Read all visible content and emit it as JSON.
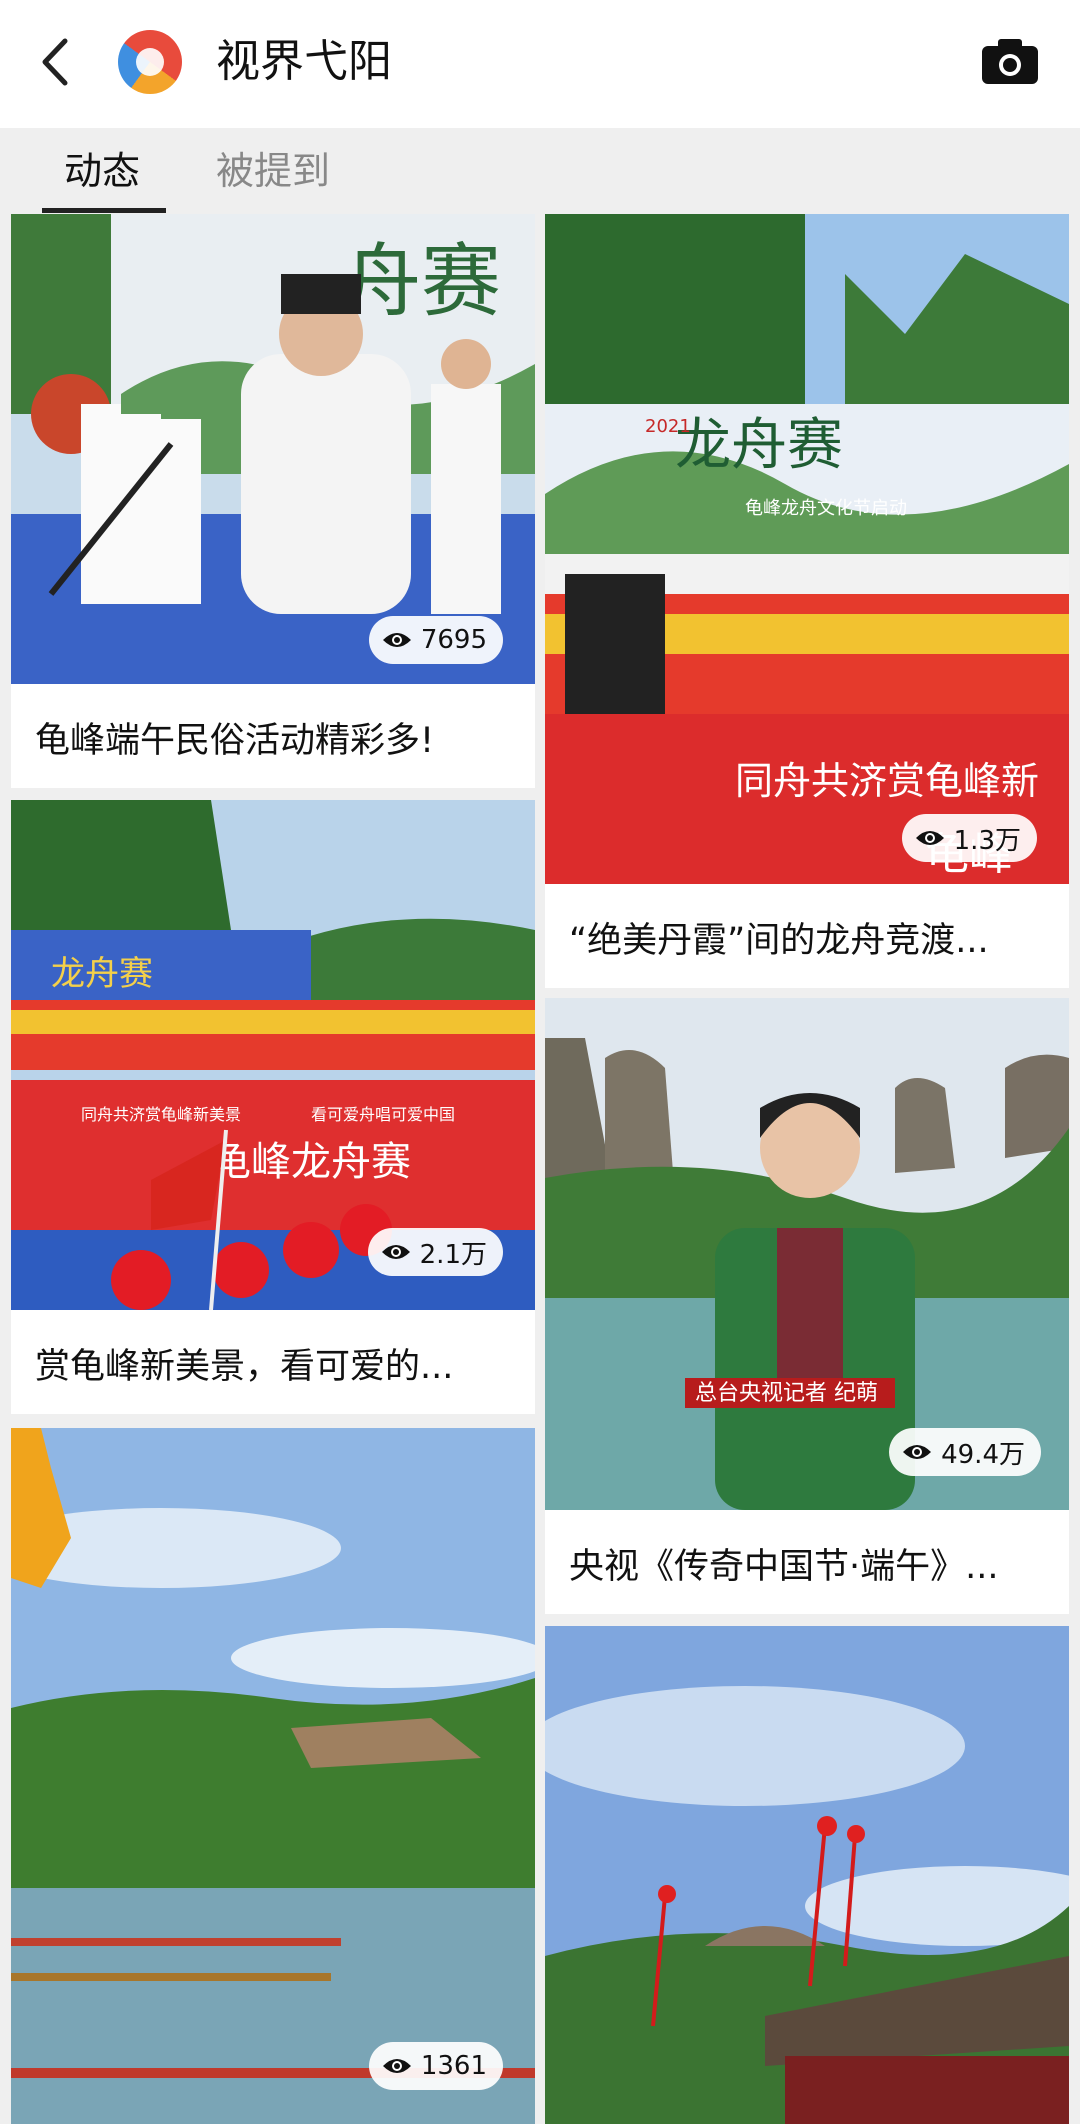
{
  "header": {
    "title": "视界弋阳",
    "back_icon": "back-arrow-icon",
    "camera_icon": "camera-icon"
  },
  "tabs": [
    {
      "label": "动态",
      "active": true
    },
    {
      "label": "被提到",
      "active": false
    }
  ],
  "cards": {
    "c1": {
      "caption": "龟峰端午民俗活动精彩多!",
      "views": "7695"
    },
    "c2": {
      "caption": "“绝美丹霞”间的龙舟竞渡...",
      "views": "1.3万"
    },
    "c3": {
      "caption": "赏龟峰新美景，看可爱的...",
      "views": "2.1万"
    },
    "c4": {
      "caption": "央视《传奇中国节·端午》...",
      "views": "49.4万"
    },
    "c5": {
      "caption": "",
      "views": "1361"
    }
  },
  "image_text": {
    "banner_c2_top": "龙舟赛",
    "banner_c2_year": "2021",
    "banner_c2_sub": "龟峰龙舟文化节启动",
    "banner_c2_bottom": "同舟共济赏龟峰新",
    "banner_c2_bottom2": "龟峰",
    "banner_c1": "舟赛",
    "banner_c3_top": "龙舟赛",
    "banner_c3_line1": "同舟共济赏龟峰新美景",
    "banner_c3_line2": "看可爱舟唱可爱中国",
    "banner_c3_main": "龟峰龙舟赛",
    "c4_lower_third": "总台央视记者  纪萌"
  },
  "colors": {
    "header_bg": "#ffffff",
    "page_bg": "#efefef",
    "tab_active": "#111111",
    "tab_inactive": "#888888",
    "stage_red": "#d42a2a"
  }
}
